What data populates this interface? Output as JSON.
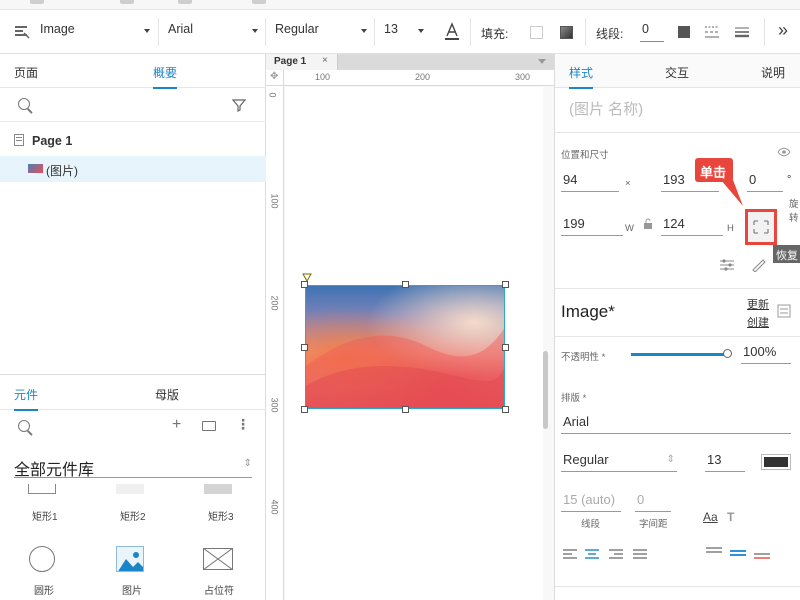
{
  "toolbar": {
    "widget_type": "Image",
    "font_family": "Arial",
    "font_weight": "Regular",
    "font_size": "13",
    "fill_label": "填充:",
    "stroke_label": "线段:",
    "stroke_width": "0",
    "more": "»"
  },
  "left_panel": {
    "tab_pages": "页面",
    "tab_outline": "概要",
    "outline": {
      "page_name": "Page 1",
      "item_name": "(图片)"
    },
    "tab_widgets": "元件",
    "tab_masters": "母版",
    "library_name": "全部元件库",
    "widgets": [
      {
        "label": "矩形1",
        "icon": "rectangle-icon"
      },
      {
        "label": "矩形2",
        "icon": "rectangle-filled-icon"
      },
      {
        "label": "矩形3",
        "icon": "rectangle-grey-icon"
      },
      {
        "label": "圆形",
        "icon": "circle-icon"
      },
      {
        "label": "图片",
        "icon": "image-icon"
      },
      {
        "label": "占位符",
        "icon": "placeholder-icon"
      }
    ]
  },
  "canvas": {
    "page_tab": "Page 1",
    "ruler_top": [
      "100",
      "200",
      "300"
    ],
    "ruler_left": [
      "0",
      "100",
      "200",
      "300",
      "400"
    ]
  },
  "right_panel": {
    "tab_style": "样式",
    "tab_interact": "交互",
    "tab_notes": "说明",
    "name_placeholder": "(图片 名称)",
    "position_size_label": "位置和尺寸",
    "x": "94",
    "y": "193",
    "rotation": "0",
    "rotate_label": "旋转",
    "w": "199",
    "h": "124",
    "callout_text": "单击",
    "tooltip_text": "恢复",
    "style_name": "Image*",
    "update_label": "更新",
    "create_label": "创建",
    "opacity_label": "不透明性 *",
    "opacity_value": "100%",
    "opacity": 1.0,
    "typography_label": "排版 *",
    "font_family": "Arial",
    "font_weight": "Regular",
    "font_size": "13",
    "line_height": "15 (auto)",
    "letter_spacing": "0",
    "line_spacing_label": "线段",
    "letter_spacing_label": "字间距",
    "aa_label": "Aa",
    "accent_color": "#1a86c8",
    "callout_color": "#e8453c"
  }
}
